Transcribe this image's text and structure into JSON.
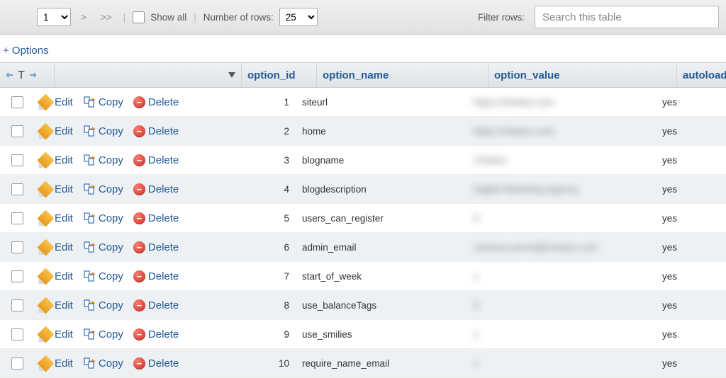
{
  "toolbar": {
    "page_value": "1",
    "next_label": ">",
    "last_label": ">>",
    "showall_label": "Show all",
    "rows_label": "Number of rows:",
    "rows_value": "25",
    "filter_label": "Filter rows:",
    "search_placeholder": "Search this table"
  },
  "options_link": "+ Options",
  "columns": {
    "id": "option_id",
    "name": "option_name",
    "value": "option_value",
    "autoload": "autoload"
  },
  "action_labels": {
    "edit": "Edit",
    "copy": "Copy",
    "del": "Delete"
  },
  "rows": [
    {
      "id": "1",
      "name": "siteurl",
      "value": "https://chelaru.com",
      "autoload": "yes"
    },
    {
      "id": "2",
      "name": "home",
      "value": "https://chelaru.com",
      "autoload": "yes"
    },
    {
      "id": "3",
      "name": "blogname",
      "value": "Chelaru",
      "autoload": "yes"
    },
    {
      "id": "4",
      "name": "blogdescription",
      "value": "Digital Marketing Agency",
      "autoload": "yes"
    },
    {
      "id": "5",
      "name": "users_can_register",
      "value": "0",
      "autoload": "yes"
    },
    {
      "id": "6",
      "name": "admin_email",
      "value": "chelena.verma@chelaru.com",
      "autoload": "yes"
    },
    {
      "id": "7",
      "name": "start_of_week",
      "value": "1",
      "autoload": "yes"
    },
    {
      "id": "8",
      "name": "use_balanceTags",
      "value": "0",
      "autoload": "yes"
    },
    {
      "id": "9",
      "name": "use_smilies",
      "value": "1",
      "autoload": "yes"
    },
    {
      "id": "10",
      "name": "require_name_email",
      "value": "1",
      "autoload": "yes"
    }
  ]
}
